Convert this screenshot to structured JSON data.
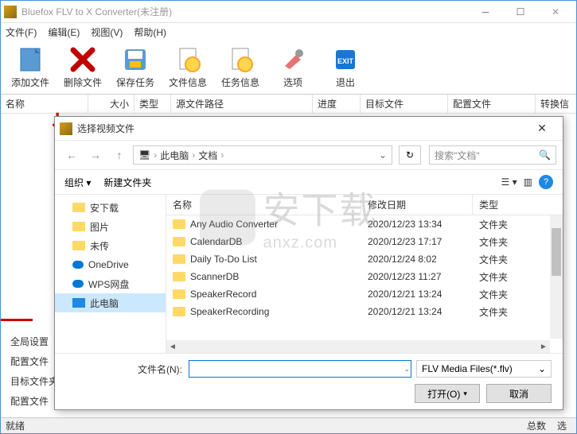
{
  "window": {
    "title": "Bluefox FLV to X Converter(未注册)"
  },
  "menu": {
    "file": "文件(F)",
    "edit": "编辑(E)",
    "view": "视图(V)",
    "help": "帮助(H)"
  },
  "toolbar": {
    "add": "添加文件",
    "delete": "删除文件",
    "save": "保存任务",
    "fileinfo": "文件信息",
    "taskinfo": "任务信息",
    "options": "选项",
    "exit": "退出"
  },
  "columns": {
    "name": "名称",
    "size": "大小",
    "type": "类型",
    "srcpath": "源文件路径",
    "progress": "进度",
    "target": "目标文件",
    "config": "配置文件",
    "convert": "转换信"
  },
  "settings": {
    "global": "全局设置",
    "config": "配置文件",
    "target": "目标文件夹",
    "config2": "配置文件"
  },
  "status": {
    "text": "就绪",
    "total": "总数",
    "select": "选"
  },
  "dialog": {
    "title": "选择视频文件",
    "breadcrumb": {
      "pc": "此电脑",
      "docs": "文档"
    },
    "search_placeholder": "搜索\"文档\"",
    "organize": "组织",
    "newfolder": "新建文件夹",
    "cols": {
      "name": "名称",
      "date": "修改日期",
      "type": "类型"
    },
    "sidebar": {
      "items": [
        {
          "label": "安下载",
          "kind": "folder"
        },
        {
          "label": "图片",
          "kind": "folder"
        },
        {
          "label": "未传",
          "kind": "folder"
        },
        {
          "label": "OneDrive",
          "kind": "cloud"
        },
        {
          "label": "WPS网盘",
          "kind": "cloud"
        },
        {
          "label": "此电脑",
          "kind": "pc",
          "selected": true
        }
      ]
    },
    "files": [
      {
        "name": "Any Audio Converter",
        "date": "2020/12/23 13:34",
        "type": "文件夹"
      },
      {
        "name": "CalendarDB",
        "date": "2020/12/23 17:17",
        "type": "文件夹"
      },
      {
        "name": "Daily To-Do List",
        "date": "2020/12/24 8:02",
        "type": "文件夹"
      },
      {
        "name": "ScannerDB",
        "date": "2020/12/23 11:27",
        "type": "文件夹"
      },
      {
        "name": "SpeakerRecord",
        "date": "2020/12/21 13:24",
        "type": "文件夹"
      },
      {
        "name": "SpeakerRecording",
        "date": "2020/12/21 13:24",
        "type": "文件夹"
      }
    ],
    "filename_label": "文件名(N):",
    "filename_value": "",
    "filetype": "FLV Media Files(*.flv)",
    "open": "打开(O)",
    "cancel": "取消"
  },
  "watermark": {
    "text": "安下载",
    "sub": "anxz.com"
  }
}
